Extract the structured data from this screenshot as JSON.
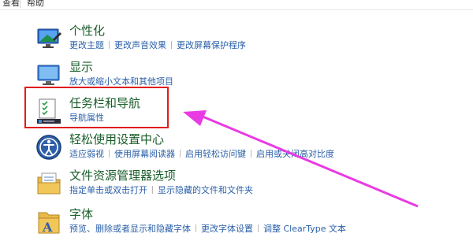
{
  "topbar": {
    "left_text": "查看",
    "right_text": "帮助"
  },
  "categories": [
    {
      "title": "个性化",
      "icon": "personalization-icon",
      "links": [
        "更改主题",
        "更改声音效果",
        "更改屏幕保护程序"
      ]
    },
    {
      "title": "显示",
      "icon": "display-icon",
      "links": [
        "放大或缩小文本和其他项目"
      ]
    },
    {
      "title": "任务栏和导航",
      "icon": "taskbar-icon",
      "links": [
        "导航属性"
      ]
    },
    {
      "title": "轻松使用设置中心",
      "icon": "ease-of-access-icon",
      "links": [
        "适应弱视",
        "使用屏幕阅读器",
        "启用轻松访问键",
        "启用或关闭高对比度"
      ]
    },
    {
      "title": "文件资源管理器选项",
      "icon": "folder-options-icon",
      "links": [
        "指定单击或双击打开",
        "显示隐藏的文件和文件夹"
      ]
    },
    {
      "title": "字体",
      "icon": "fonts-icon",
      "links": [
        "预览、删除或者显示和隐藏字体",
        "更改字体设置",
        "调整 ClearType 文本"
      ]
    }
  ],
  "annotation": {
    "box_color": "#e11b1b",
    "arrow_color": "#e93be3"
  },
  "colors": {
    "title_green": "#1a5e2a",
    "link_blue": "#2a5fa8"
  }
}
